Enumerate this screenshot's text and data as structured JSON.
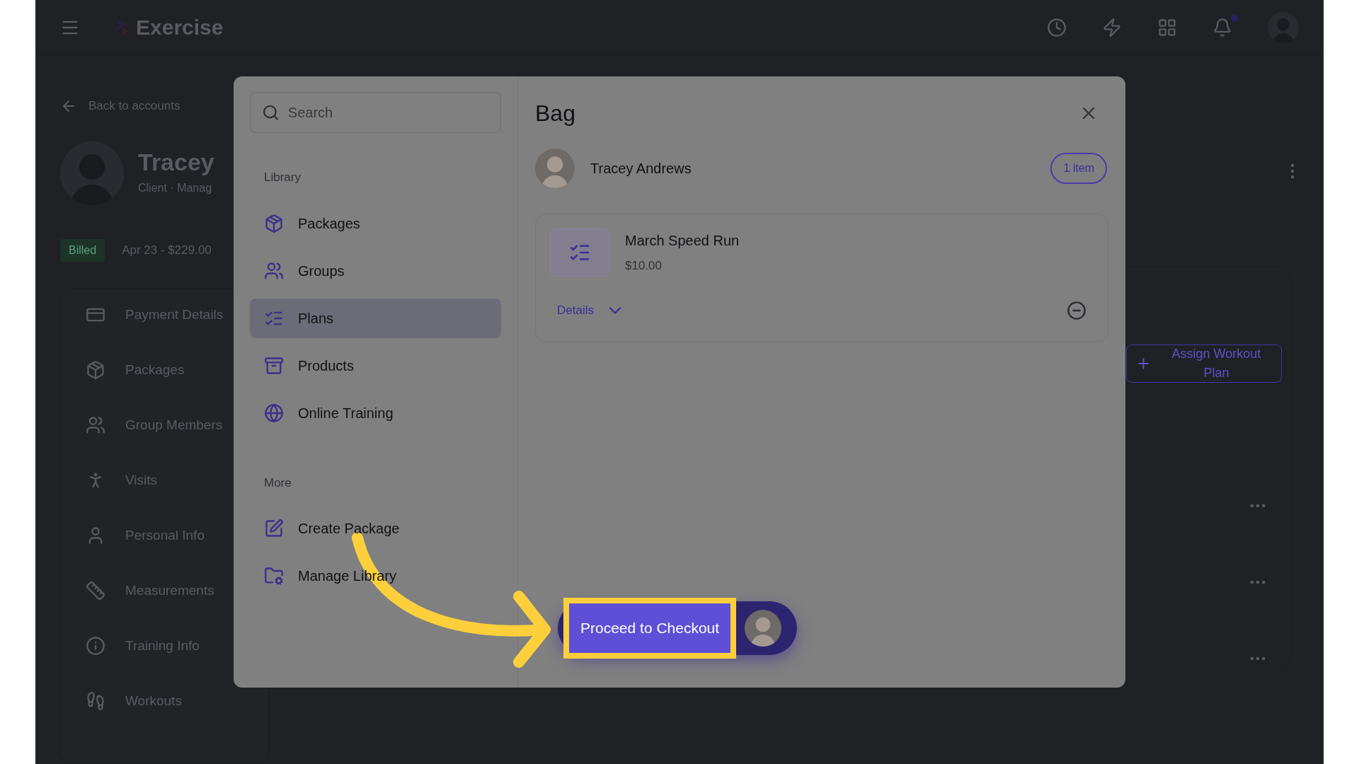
{
  "app": {
    "title": "Exercise"
  },
  "background": {
    "back_link": "Back to accounts",
    "client_name": "Tracey",
    "client_meta": "Client · Manag",
    "status_badge": "Billed",
    "billing": "Apr 23 - $229.00",
    "nav": [
      {
        "label": "Payment Details"
      },
      {
        "label": "Packages"
      },
      {
        "label": "Group Members"
      },
      {
        "label": "Visits"
      },
      {
        "label": "Personal Info"
      },
      {
        "label": "Measurements"
      },
      {
        "label": "Training Info"
      },
      {
        "label": "Workouts"
      }
    ],
    "assign_button": "Assign Workout Plan"
  },
  "modal": {
    "search": {
      "placeholder": "Search"
    },
    "sections": [
      {
        "title": "Library",
        "items": [
          {
            "label": "Packages",
            "selected": false
          },
          {
            "label": "Groups",
            "selected": false
          },
          {
            "label": "Plans",
            "selected": true
          },
          {
            "label": "Products",
            "selected": false
          },
          {
            "label": "Online Training",
            "selected": false
          }
        ]
      },
      {
        "title": "More",
        "items": [
          {
            "label": "Create Package",
            "selected": false
          },
          {
            "label": "Manage Library",
            "selected": false
          }
        ]
      }
    ],
    "bag": {
      "title": "Bag",
      "customer": "Tracey Andrews",
      "count": "1 item",
      "items": [
        {
          "name": "March Speed Run",
          "price": "$10.00",
          "details": "Details",
          "expanded": false
        }
      ]
    },
    "checkout": "Proceed to Checkout"
  }
}
